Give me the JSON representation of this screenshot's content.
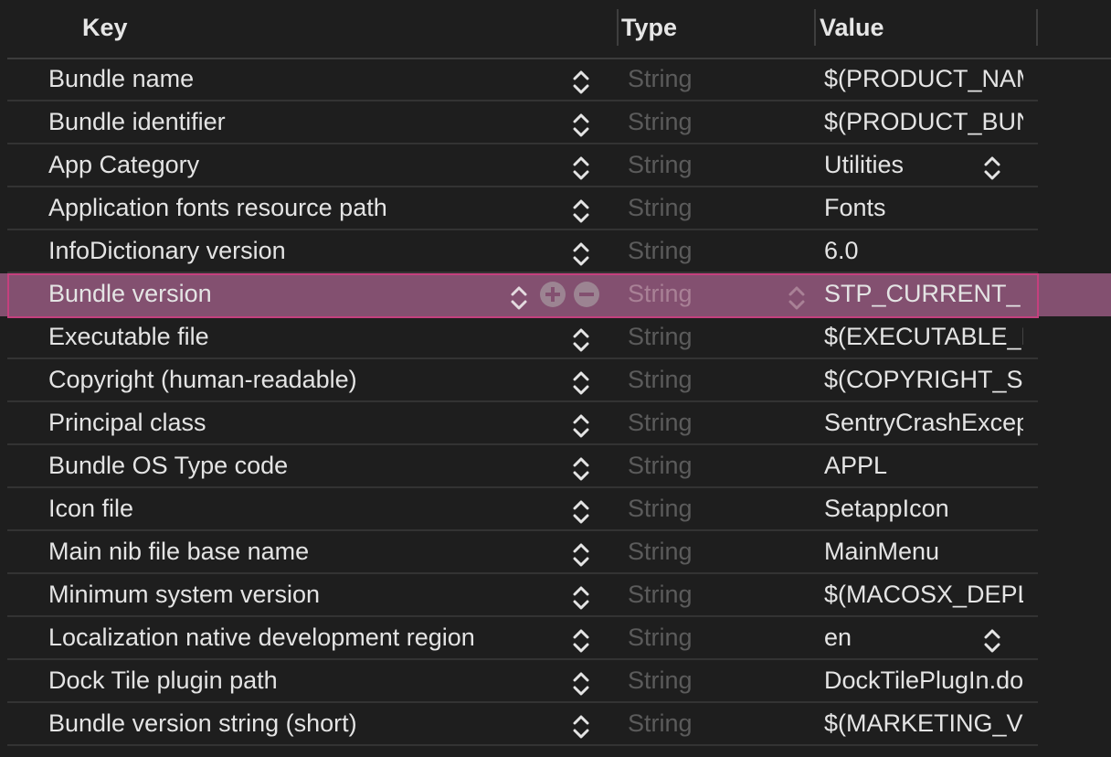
{
  "header": {
    "key_label": "Key",
    "type_label": "Type",
    "value_label": "Value"
  },
  "icons": {
    "stepper": "up-down-chevron-icon",
    "add": "plus-circle-icon",
    "remove": "minus-circle-icon"
  },
  "colors": {
    "background": "#1e1e1e",
    "selection": "#835070",
    "selection_border": "#c4407e",
    "text": "#e4e4e4",
    "type_text": "#5b5b5b"
  },
  "rows": [
    {
      "key": "Bundle name",
      "type": "String",
      "value": "$(PRODUCT_NAME)",
      "value_popup": false,
      "selected": false
    },
    {
      "key": "Bundle identifier",
      "type": "String",
      "value": "$(PRODUCT_BUNDLE_IDENTIFIER)",
      "value_popup": false,
      "selected": false
    },
    {
      "key": "App Category",
      "type": "String",
      "value": "Utilities",
      "value_popup": true,
      "selected": false
    },
    {
      "key": "Application fonts resource path",
      "type": "String",
      "value": "Fonts",
      "value_popup": false,
      "selected": false
    },
    {
      "key": "InfoDictionary version",
      "type": "String",
      "value": "6.0",
      "value_popup": false,
      "selected": false
    },
    {
      "key": "Bundle version",
      "type": "String",
      "value": "STP_CURRENT_",
      "value_popup": false,
      "selected": true
    },
    {
      "key": "Executable file",
      "type": "String",
      "value": "$(EXECUTABLE_NAME)",
      "value_popup": false,
      "selected": false
    },
    {
      "key": "Copyright (human-readable)",
      "type": "String",
      "value": "$(COPYRIGHT_STRING)",
      "value_popup": false,
      "selected": false
    },
    {
      "key": "Principal class",
      "type": "String",
      "value": "SentryCrashExceptionApplication",
      "value_popup": false,
      "selected": false
    },
    {
      "key": "Bundle OS Type code",
      "type": "String",
      "value": "APPL",
      "value_popup": false,
      "selected": false
    },
    {
      "key": "Icon file",
      "type": "String",
      "value": "SetappIcon",
      "value_popup": false,
      "selected": false
    },
    {
      "key": "Main nib file base name",
      "type": "String",
      "value": "MainMenu",
      "value_popup": false,
      "selected": false
    },
    {
      "key": "Minimum system version",
      "type": "String",
      "value": "$(MACOSX_DEPLOYMENT_TARGET)",
      "value_popup": false,
      "selected": false
    },
    {
      "key": "Localization native development region",
      "type": "String",
      "value": "en",
      "value_popup": true,
      "selected": false
    },
    {
      "key": "Dock Tile plugin path",
      "type": "String",
      "value": "DockTilePlugIn.docktileplugin",
      "value_popup": false,
      "selected": false
    },
    {
      "key": "Bundle version string (short)",
      "type": "String",
      "value": "$(MARKETING_VERSION)",
      "value_popup": false,
      "selected": false
    }
  ]
}
